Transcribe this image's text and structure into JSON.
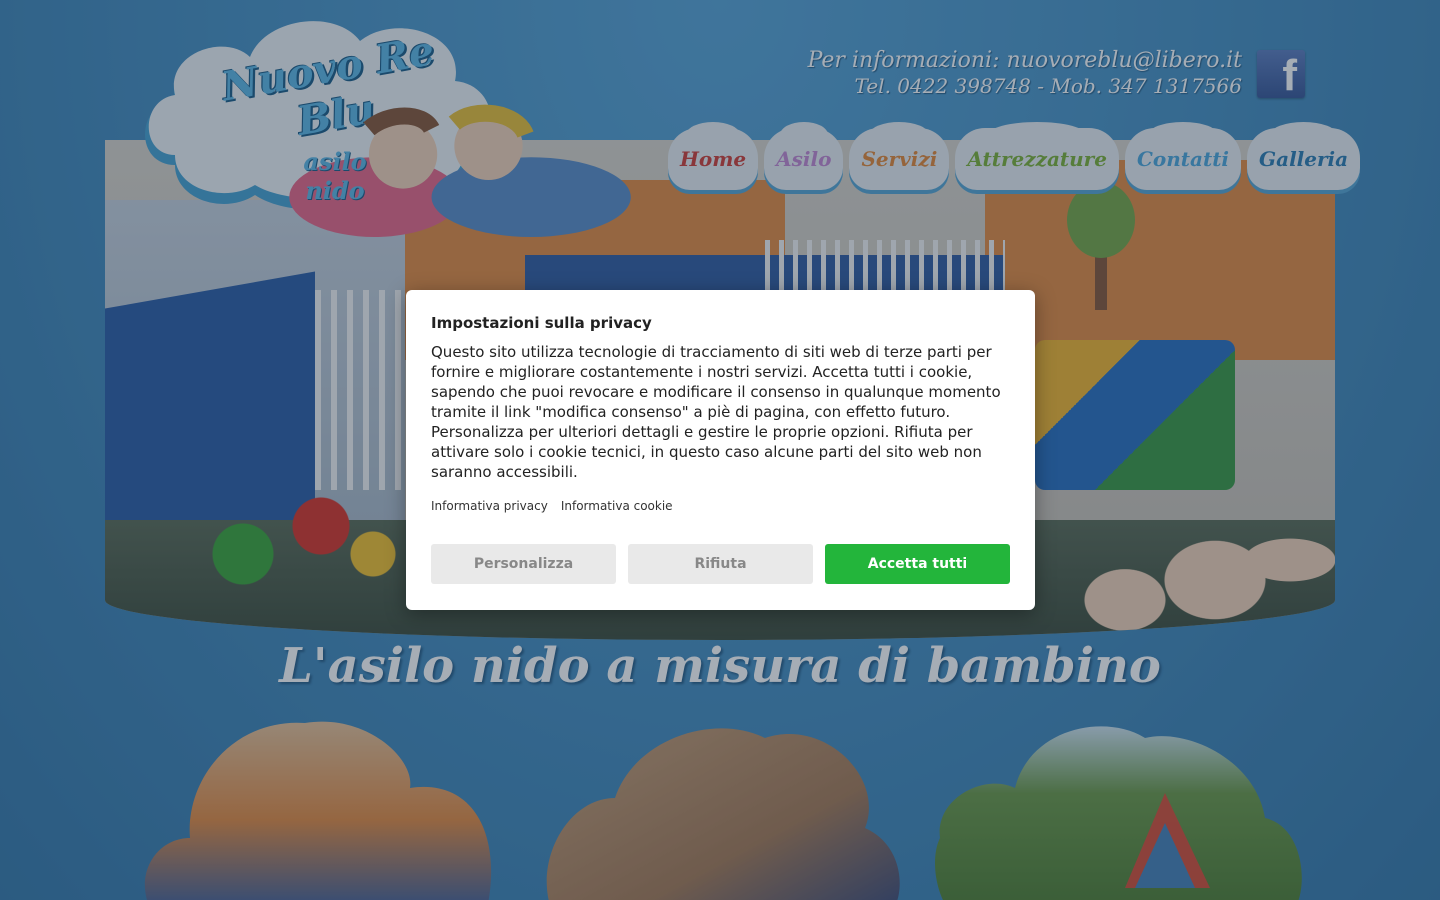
{
  "header": {
    "contact_line1": "Per informazioni: nuovoreblu@libero.it",
    "contact_line2": "Tel. 0422 398748 - Mob. 347 1317566",
    "facebook_icon": "facebook-icon",
    "facebook_glyph": "f"
  },
  "logo": {
    "title": "Nuovo Re Blu",
    "subtitle": "asilo nido"
  },
  "nav": {
    "items": [
      {
        "label": "Home",
        "color": "#d0413a"
      },
      {
        "label": "Asilo",
        "color": "#c48ad2"
      },
      {
        "label": "Servizi",
        "color": "#e48a3a"
      },
      {
        "label": "Attrezzature",
        "color": "#7fb23a"
      },
      {
        "label": "Contatti",
        "color": "#4fa8dc"
      },
      {
        "label": "Galleria",
        "color": "#2f7fb4"
      }
    ]
  },
  "tagline": "L'asilo nido a misura di bambino",
  "cookie_modal": {
    "title": "Impostazioni sulla privacy",
    "text": "Questo sito utilizza tecnologie di tracciamento di siti web di terze parti per fornire e migliorare costantemente i nostri servizi. Accetta tutti i cookie, sapendo che puoi revocare e modificare il consenso in qualunque momento tramite il link \"modifica consenso\" a piè di pagina, con effetto futuro. Personalizza per ulteriori dettagli e gestire le proprie opzioni. Rifiuta per attivare solo i cookie tecnici, in questo caso alcune parti del sito web non saranno accessibili.",
    "link_privacy": "Informativa privacy",
    "link_cookie": "Informativa cookie",
    "btn_customize": "Personalizza",
    "btn_reject": "Rifiuta",
    "btn_accept": "Accetta tutti",
    "accept_color": "#23b53b"
  }
}
